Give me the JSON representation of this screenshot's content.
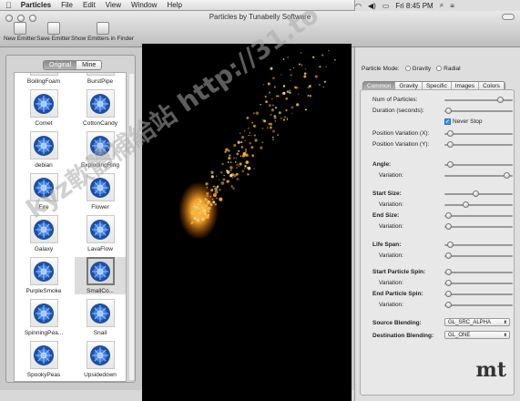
{
  "menubar": {
    "app": "Particles",
    "items": [
      "File",
      "Edit",
      "View",
      "Window",
      "Help"
    ],
    "clock": "Fri 8:45 PM"
  },
  "window": {
    "title": "Particles by Tunabelly Software",
    "toolbar": {
      "new_emitter": "New Emitter",
      "save_emitter": "Save Emitter",
      "show_emitters": "Show Emitters in Finder"
    }
  },
  "library": {
    "segments": [
      "Original",
      "Mine"
    ],
    "active_segment": "Original",
    "items": [
      {
        "label": "BoilingFoam"
      },
      {
        "label": "BurstPipe"
      },
      {
        "label": "Comet"
      },
      {
        "label": "CottonCandy"
      },
      {
        "label": "debian"
      },
      {
        "label": "ExplodingRing"
      },
      {
        "label": "Fire"
      },
      {
        "label": "Flower"
      },
      {
        "label": "Galaxy"
      },
      {
        "label": "LavaFlow"
      },
      {
        "label": "PurpleSmoke"
      },
      {
        "label": "SmallCo..."
      },
      {
        "label": "SpinningPea..."
      },
      {
        "label": "Snail"
      },
      {
        "label": "SpookyPeas"
      },
      {
        "label": "Upsidedown"
      }
    ],
    "selected": "SmallCo..."
  },
  "inspector": {
    "mode_label": "Particle Mode:",
    "modes": [
      "Gravity",
      "Radial"
    ],
    "tabs": [
      "Common",
      "Gravity",
      "Specific",
      "Images",
      "Colors"
    ],
    "active_tab": "Common",
    "labels": {
      "num_particles": "Num of Particles:",
      "duration": "Duration (seconds):",
      "never_stop": "Never Stop",
      "pos_var_x": "Position Variation (X):",
      "pos_var_y": "Position Variation (Y):",
      "angle": "Angle:",
      "variation": "Variation:",
      "start_size": "Start Size:",
      "end_size": "End Size:",
      "life_span": "Life Span:",
      "start_spin": "Start Particle Spin:",
      "end_spin": "End Particle Spin:",
      "source_blending": "Source Blending:",
      "dest_blending": "Destination Blending:"
    },
    "never_stop_checked": true,
    "slider_levels": {
      "num_particles": 0.85,
      "duration": 0.02,
      "pos_var_x": 0.05,
      "pos_var_y": 0.05,
      "angle": 0.05,
      "angle_var": 0.95,
      "start_size": 0.45,
      "start_size_var": 0.3,
      "end_size": 0.02,
      "end_size_var": 0.02,
      "life_span": 0.05,
      "life_span_var": 0.02,
      "start_spin": 0.02,
      "start_spin_var": 0.02,
      "end_spin": 0.02,
      "end_spin_var": 0.02
    },
    "source_blending": "GL_SRC_ALPHA",
    "dest_blending": "GL_ONE",
    "logo": "mt"
  },
  "watermark": "kyz軟體補給站 http://31.to",
  "colors": {
    "particle": "#ffb030",
    "selection": "#777777"
  }
}
